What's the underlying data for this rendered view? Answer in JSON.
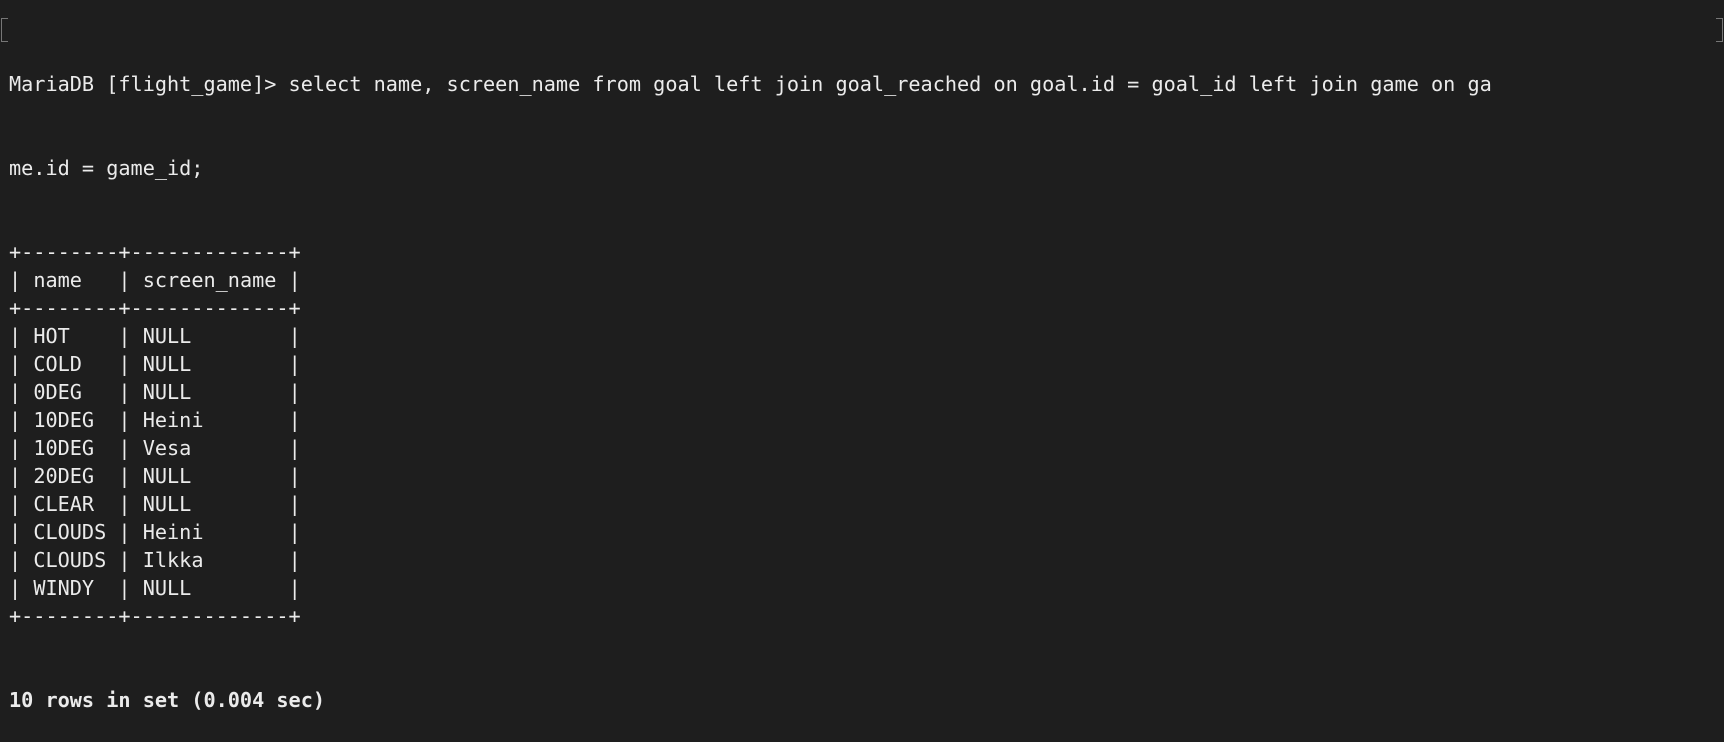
{
  "terminal": {
    "prompt": "MariaDB [flight_game]> ",
    "command_line1": "select name, screen_name from goal left join goal_reached on goal.id = goal_id left join game on ga",
    "command_line2": "me.id = game_id;",
    "columns": [
      "name",
      "screen_name"
    ],
    "rows": [
      [
        "HOT",
        "NULL"
      ],
      [
        "COLD",
        "NULL"
      ],
      [
        "0DEG",
        "NULL"
      ],
      [
        "10DEG",
        "Heini"
      ],
      [
        "10DEG",
        "Vesa"
      ],
      [
        "20DEG",
        "NULL"
      ],
      [
        "CLEAR",
        "NULL"
      ],
      [
        "CLOUDS",
        "Heini"
      ],
      [
        "CLOUDS",
        "Ilkka"
      ],
      [
        "WINDY",
        "NULL"
      ]
    ],
    "result_summary": "10 rows in set (0.004 sec)"
  },
  "colors": {
    "background": "#1e1e1e",
    "text": "#ebebeb"
  }
}
